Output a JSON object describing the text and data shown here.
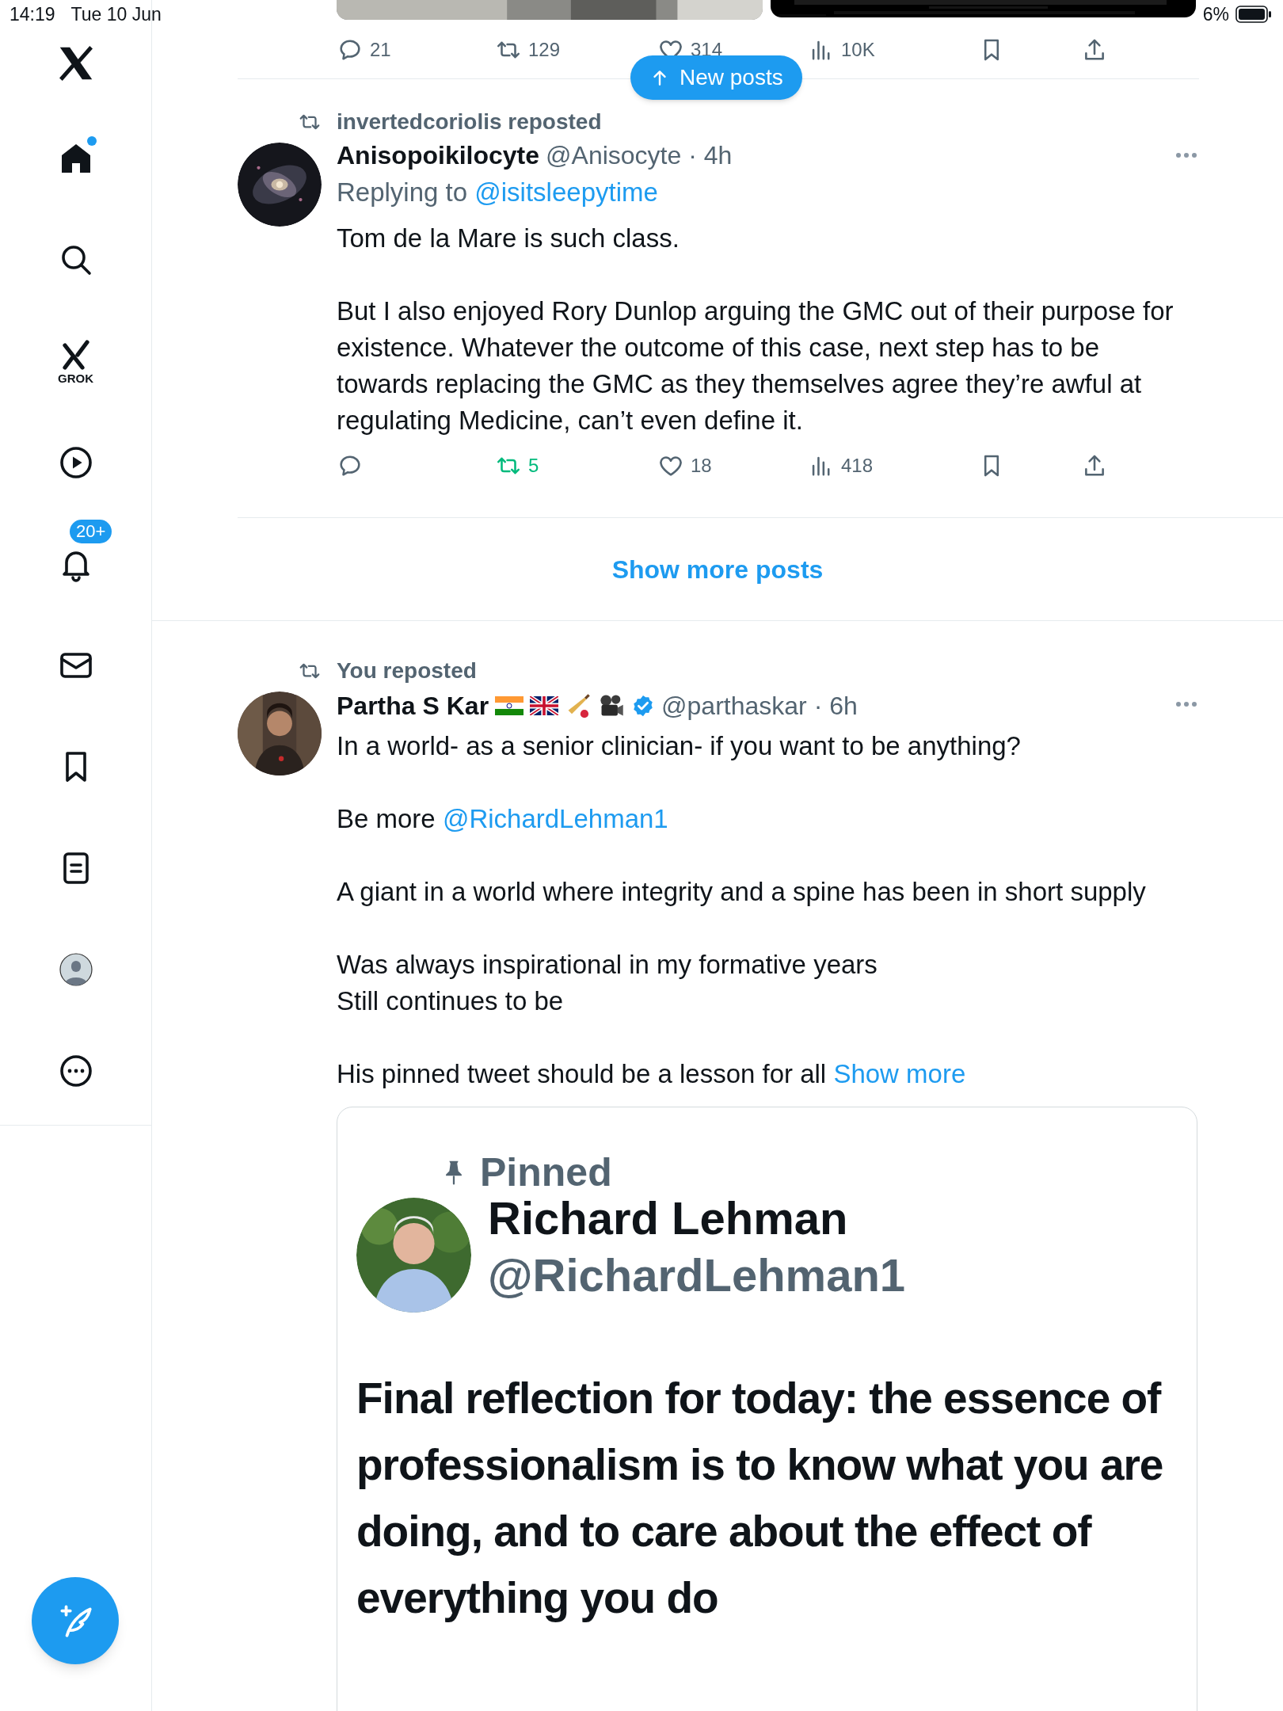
{
  "status_bar": {
    "time": "14:19",
    "date": "Tue 10 Jun",
    "battery": "6%"
  },
  "sidebar": {
    "items": [
      {
        "kind": "logo",
        "unread": false
      },
      {
        "kind": "home",
        "unread": true
      },
      {
        "kind": "search",
        "unread": false
      },
      {
        "kind": "grok",
        "label": "GROK",
        "unread": false
      },
      {
        "kind": "video",
        "unread": false
      },
      {
        "kind": "notifications",
        "unread": false,
        "badge": "20+"
      },
      {
        "kind": "messages",
        "unread": false
      },
      {
        "kind": "bookmarks",
        "unread": false
      },
      {
        "kind": "lists",
        "unread": false
      },
      {
        "kind": "profile",
        "unread": false
      },
      {
        "kind": "more",
        "unread": false
      }
    ]
  },
  "new_posts_button": "New posts",
  "feed": [
    {
      "kind": "post_tail",
      "actions": [
        {
          "kind": "reply",
          "count": "21",
          "active": false
        },
        {
          "kind": "repost",
          "count": "129",
          "active": false
        },
        {
          "kind": "like",
          "count": "314",
          "active": false
        },
        {
          "kind": "views",
          "count": "10K",
          "active": false
        },
        {
          "kind": "bookmark",
          "active": false
        },
        {
          "kind": "share",
          "active": false
        }
      ]
    },
    {
      "kind": "post",
      "reposted_by": "invertedcoriolis reposted",
      "name": "Anisopoikilocyte",
      "verified": false,
      "meta": "@Anisocyte · 4h",
      "reply_to": {
        "label": "Replying to",
        "handle": "@isitsleepytime"
      },
      "paragraphs": [
        [
          {
            "text": "Tom de la Mare is such class."
          }
        ],
        [
          {
            "text": "But I also enjoyed Rory Dunlop arguing the GMC out of their purpose for existence. Whatever the outcome of this case, next step has to be towards replacing the GMC as they themselves agree they’re awful at regulating Medicine, can’t even define it."
          }
        ]
      ],
      "actions": [
        {
          "kind": "reply",
          "active": false
        },
        {
          "kind": "repost",
          "count": "5",
          "active": true
        },
        {
          "kind": "like",
          "count": "18",
          "active": false
        },
        {
          "kind": "views",
          "count": "418",
          "active": false
        },
        {
          "kind": "bookmark",
          "active": false
        },
        {
          "kind": "share",
          "active": false
        }
      ]
    },
    {
      "kind": "show_more",
      "label": "Show more posts"
    },
    {
      "kind": "post",
      "reposted_by": "You reposted",
      "name": "Partha S Kar",
      "verified": true,
      "meta": "@parthaskar · 6h",
      "name_emoji": [
        {
          "kind": "india_flag"
        },
        {
          "kind": "uk_flag"
        },
        {
          "kind": "cricket"
        },
        {
          "kind": "film_camera"
        }
      ],
      "paragraphs": [
        [
          {
            "text": "In a world- as a senior clinician- if you want to be anything?"
          }
        ],
        [
          {
            "text": "Be more "
          },
          {
            "text": "@RichardLehman1",
            "link": true
          }
        ],
        [
          {
            "text": "A giant in a world where integrity and a spine has been in short supply"
          }
        ],
        [
          {
            "text": "Was always inspirational in my formative years\nStill continues to be"
          }
        ],
        [
          {
            "text": "His pinned tweet should be a lesson for all "
          },
          {
            "text": "Show more",
            "link": true
          }
        ]
      ],
      "quote": {
        "kind": "screenshot",
        "pinned": "Pinned",
        "name": "Richard Lehman",
        "handle": "@RichardLehman1",
        "text": "Final reflection for today: the essence of professionalism is to know what you are doing, and to care about the effect of everything you do"
      }
    }
  ]
}
